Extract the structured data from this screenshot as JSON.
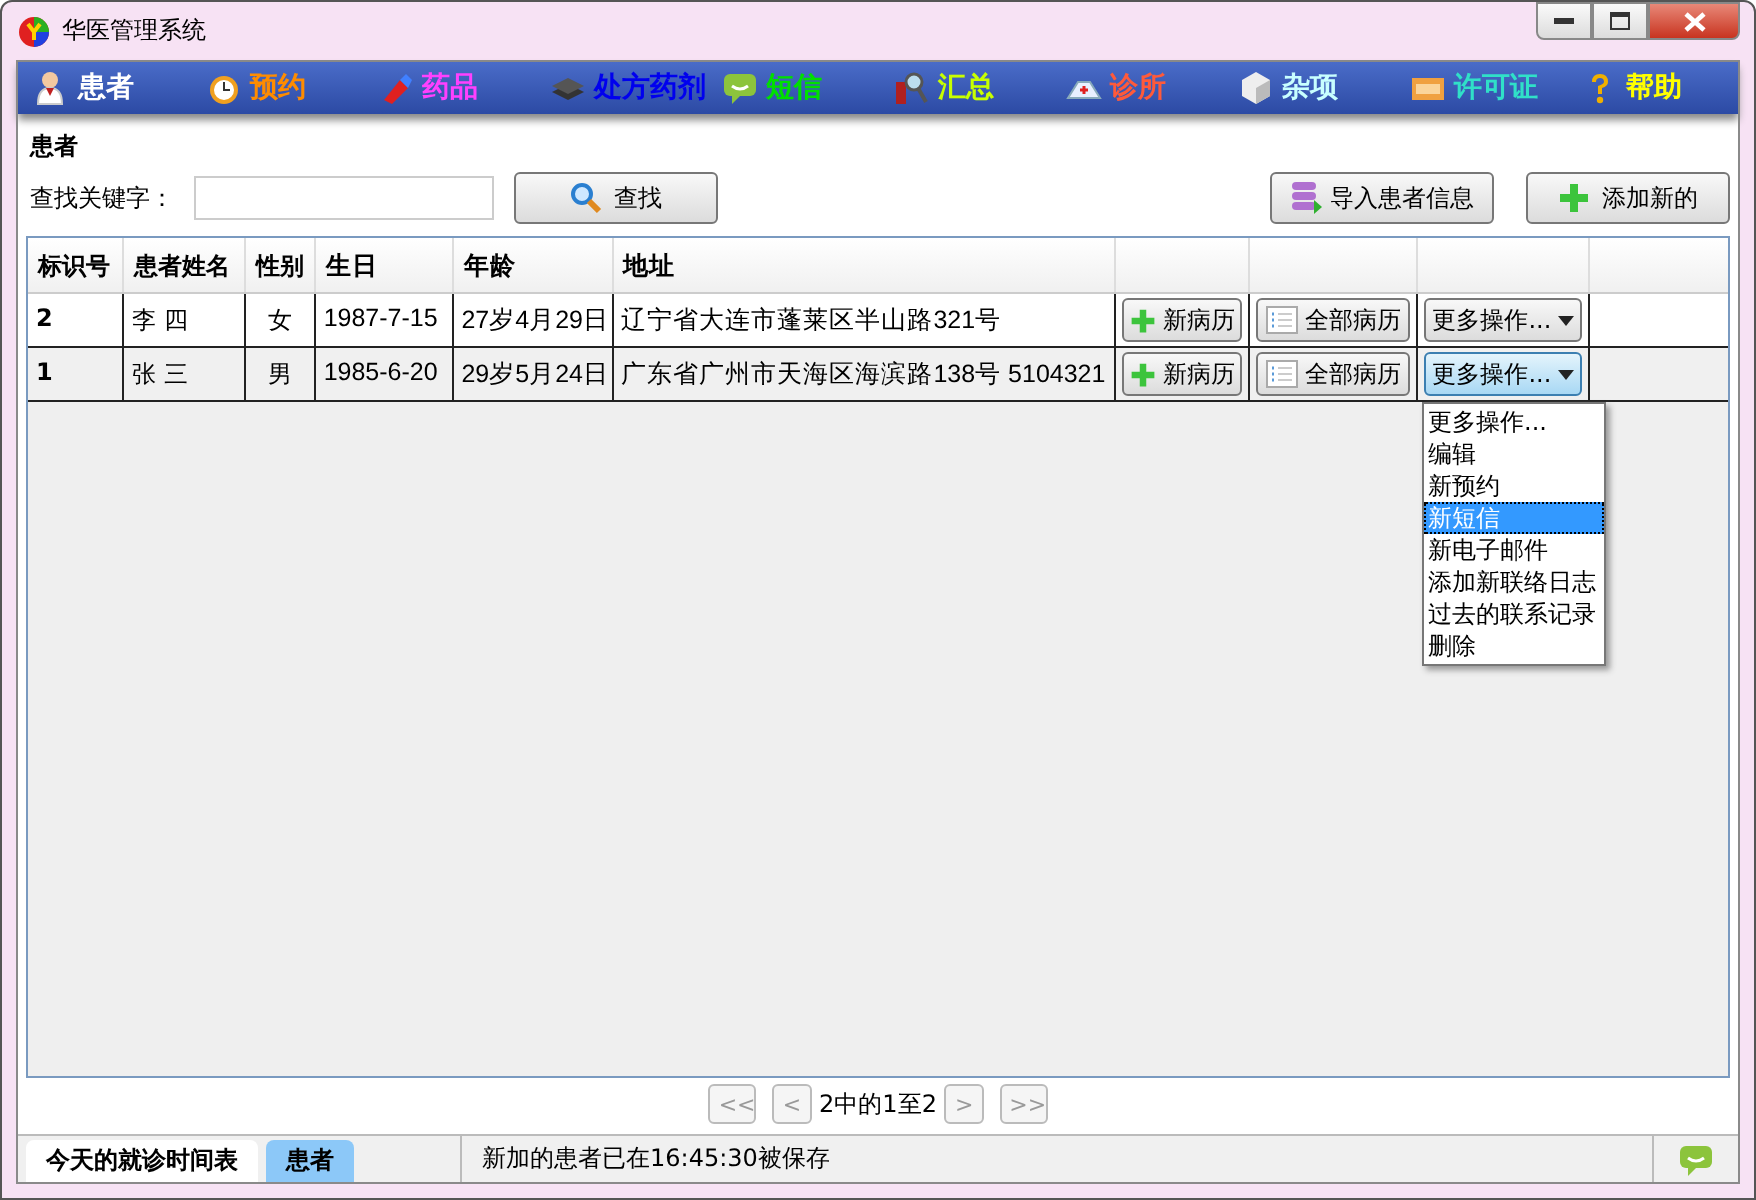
{
  "window": {
    "title": "华医管理系统"
  },
  "nav": [
    {
      "label": "患者",
      "color": "#ffffff"
    },
    {
      "label": "预约",
      "color": "#ff8c00"
    },
    {
      "label": "药品",
      "color": "#ff40ff"
    },
    {
      "label": "处方药剂",
      "color": "#0000ee"
    },
    {
      "label": "短信",
      "color": "#00e000"
    },
    {
      "label": "汇总",
      "color": "#c8ff00"
    },
    {
      "label": "诊所",
      "color": "#ff5a3a"
    },
    {
      "label": "杂项",
      "color": "#c8ffff"
    },
    {
      "label": "许可证",
      "color": "#30e0c8"
    },
    {
      "label": "帮助",
      "color": "#ffff00"
    }
  ],
  "section_title": "患者",
  "search": {
    "label": "查找关键字：",
    "button": "查找"
  },
  "actions": [
    "导入患者信息",
    "添加新的"
  ],
  "table": {
    "columns": [
      "标识号",
      "患者姓名",
      "性别",
      "生日",
      "年龄",
      "地址"
    ],
    "rows": [
      {
        "id": "2",
        "name": "李 四",
        "gender": "女",
        "birthday": "1987-7-15",
        "age": "27岁4月29日",
        "address": "辽宁省大连市蓬莱区半山路321号",
        "new_record": "新病历",
        "all_records": "全部病历",
        "more": "更多操作...",
        "active": false
      },
      {
        "id": "1",
        "name": "张 三",
        "gender": "男",
        "birthday": "1985-6-20",
        "age": "29岁5月24日",
        "address": "广东省广州市天海区海滨路138号 5104321",
        "new_record": "新病历",
        "all_records": "全部病历",
        "more": "更多操作...",
        "active": true
      }
    ]
  },
  "menu": [
    {
      "label": "更多操作...",
      "selected": false
    },
    {
      "label": "编辑",
      "selected": false
    },
    {
      "label": "新预约",
      "selected": false
    },
    {
      "label": "新短信",
      "selected": true
    },
    {
      "label": "新电子邮件",
      "selected": false
    },
    {
      "label": "添加新联络日志",
      "selected": false
    },
    {
      "label": "过去的联系记录",
      "selected": false
    },
    {
      "label": "删除",
      "selected": false
    }
  ],
  "pager": {
    "first": "<<",
    "prev": "<",
    "info": "2中的1至2",
    "next": ">",
    "last": ">>"
  },
  "status_tabs": [
    {
      "label": "今天的就诊时间表",
      "selected": false
    },
    {
      "label": "患者",
      "selected": true
    }
  ],
  "status_message": "新加的患者已在16:45:30被保存"
}
